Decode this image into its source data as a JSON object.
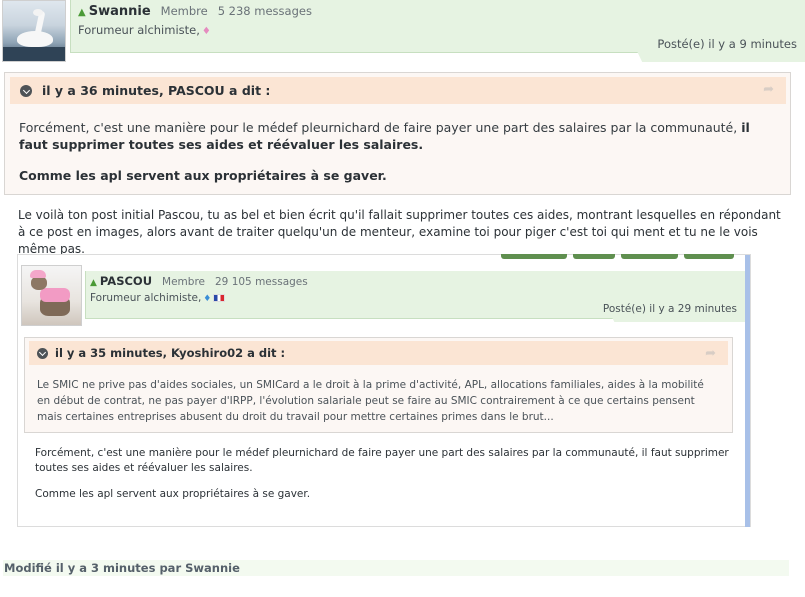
{
  "post": {
    "author": "Swannie",
    "role": "Membre",
    "messages": "5 238 messages",
    "title": "Forumeur alchimiste,",
    "gender_symbol": "♦",
    "posted": "Posté(e) il y a 9 minutes"
  },
  "quote": {
    "header": "il y a 36 minutes, PASCOU a dit :",
    "text_normal": "Forcément, c'est une manière pour le médef pleurnichard de faire payer une part des salaires par la communauté, ",
    "text_bold": "il faut supprimer toutes ses aides et réévaluer les salaires.",
    "para2_bold": "Comme les apl servent aux propriétaires à se gaver."
  },
  "reply_text": "Le voilà ton post initial Pascou, tu as bel et bien écrit qu'il fallait supprimer toutes ces aides, montrant lesquelles en répondant à ce post en images, alors avant de traiter quelqu'un de menteur, examine toi pour piger c'est toi qui ment et tu ne le vois même pas.",
  "embedded": {
    "author": "PASCOU",
    "role": "Membre",
    "messages": "29 105 messages",
    "title": "Forumeur alchimiste,",
    "gender_symbol": "♦",
    "posted": "Posté(e) il y a 29 minutes",
    "quote": {
      "header": "il y a 35 minutes, Kyoshiro02 a dit :",
      "text": "Le SMIC ne prive pas d'aides sociales, un SMICard a le droit à la prime d'activité, APL, allocations familiales, aides à la mobilité en début de contrat, ne pas payer d'IRPP, l'évolution salariale peut se faire au SMIC contrairement à ce que certains pensent mais certaines entreprises abusent du droit du travail pour mettre certaines primes dans le brut..."
    },
    "body_p1": "Forcément, c'est une manière pour le médef pleurnichard de faire payer une part des salaires par la communauté, il faut supprimer toutes ses aides et réévaluer les salaires.",
    "body_p2": "Comme les apl servent aux propriétaires à se gaver."
  },
  "edited": "Modifié il y a 3 minutes par Swannie",
  "icons": {
    "person": "▲",
    "share": "➦"
  },
  "colors": {
    "header_green": "#e6f3e2",
    "quote_header": "#fbe5d4",
    "quote_bg": "#fcf7f4",
    "scrollbar": "#a8c0e8"
  }
}
